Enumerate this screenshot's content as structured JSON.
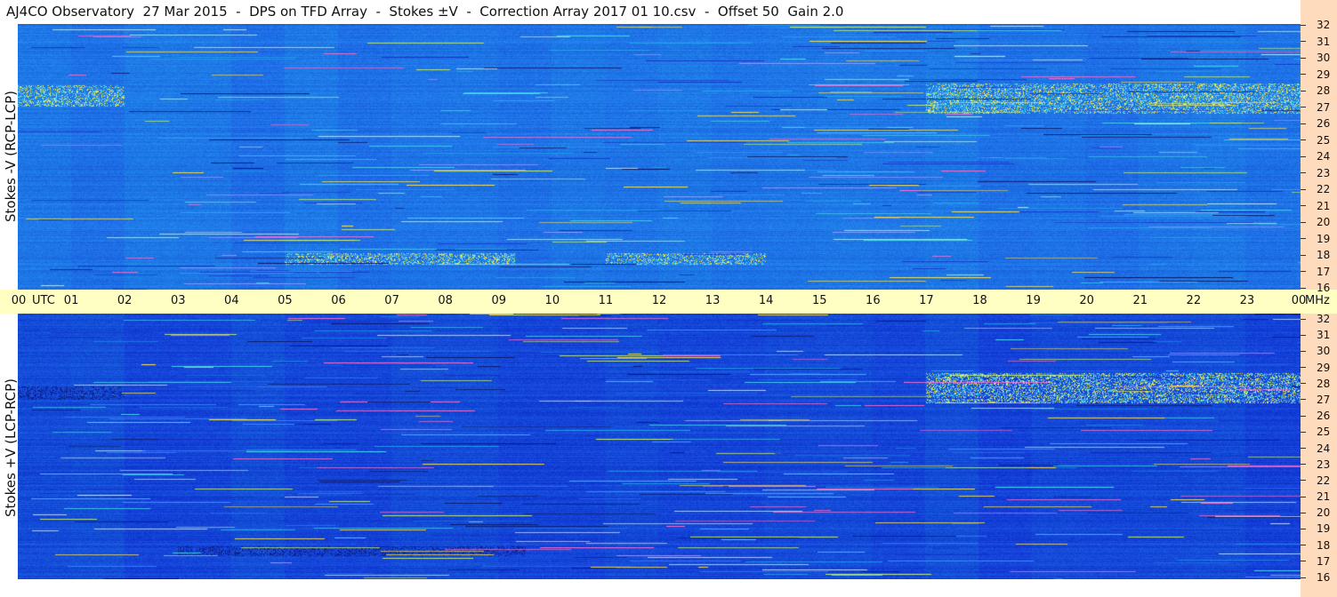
{
  "title": "AJ4CO Observatory  27 Mar 2015  -  DPS on TFD Array  -  Stokes ±V  -  Correction Array 2017 01 10.csv  -  Offset 50  Gain 2.0",
  "chart_data": [
    {
      "type": "heatmap",
      "ylabel": "Stokes -V (RCP-LCP)",
      "x_unit": "UTC",
      "y_unit": "MHz",
      "xlim": [
        0,
        24
      ],
      "ylim": [
        16,
        32
      ],
      "x_ticks": [
        "00",
        "01",
        "02",
        "03",
        "04",
        "05",
        "06",
        "07",
        "08",
        "09",
        "10",
        "11",
        "12",
        "13",
        "14",
        "15",
        "16",
        "17",
        "18",
        "19",
        "20",
        "21",
        "22",
        "23",
        "00"
      ],
      "y_ticks": [
        "32",
        "31",
        "30",
        "29",
        "28",
        "27",
        "26",
        "25",
        "24",
        "23",
        "22",
        "21",
        "20",
        "19",
        "18",
        "17",
        "16"
      ],
      "base_color": "#1e74e6",
      "palette": [
        "#0a1a6e",
        "#1233c8",
        "#1e74e6",
        "#28a4f0",
        "#47d6f2",
        "#c8f06a",
        "#ffe14a",
        "#ff6fd0"
      ],
      "bands_mhz": [
        {
          "from": 27.0,
          "to": 28.3,
          "utc_from": 0,
          "utc_to": 2,
          "level": "high"
        },
        {
          "from": 26.6,
          "to": 28.4,
          "utc_from": 17,
          "utc_to": 24,
          "level": "high"
        },
        {
          "from": 17.5,
          "to": 18.2,
          "utc_from": 5,
          "utc_to": 9.3,
          "level": "high"
        },
        {
          "from": 17.5,
          "to": 18.2,
          "utc_from": 11,
          "utc_to": 14,
          "level": "high"
        }
      ]
    },
    {
      "type": "heatmap",
      "ylabel": "Stokes +V (LCP-RCP)",
      "x_unit": "UTC",
      "y_unit": "MHz",
      "xlim": [
        0,
        24
      ],
      "ylim": [
        16,
        32
      ],
      "x_ticks": [
        "00",
        "01",
        "02",
        "03",
        "04",
        "05",
        "06",
        "07",
        "08",
        "09",
        "10",
        "11",
        "12",
        "13",
        "14",
        "15",
        "16",
        "17",
        "18",
        "19",
        "20",
        "21",
        "22",
        "23",
        "00"
      ],
      "y_ticks": [
        "32",
        "31",
        "30",
        "29",
        "28",
        "27",
        "26",
        "25",
        "24",
        "23",
        "22",
        "21",
        "20",
        "19",
        "18",
        "17",
        "16"
      ],
      "base_color": "#1448d8",
      "palette": [
        "#0a1a6e",
        "#1233c8",
        "#1e74e6",
        "#28a4f0",
        "#47d6f2",
        "#c8f06a",
        "#ffe14a",
        "#ff6fd0"
      ],
      "bands_mhz": [
        {
          "from": 26.6,
          "to": 28.4,
          "utc_from": 17,
          "utc_to": 24,
          "level": "high"
        },
        {
          "from": 26.8,
          "to": 27.6,
          "utc_from": 0,
          "utc_to": 2,
          "level": "low"
        },
        {
          "from": 17.4,
          "to": 18.0,
          "utc_from": 3,
          "utc_to": 9.5,
          "level": "low"
        }
      ]
    }
  ],
  "time_axis": {
    "utc_label": "UTC",
    "mhz_label": "MHz"
  }
}
